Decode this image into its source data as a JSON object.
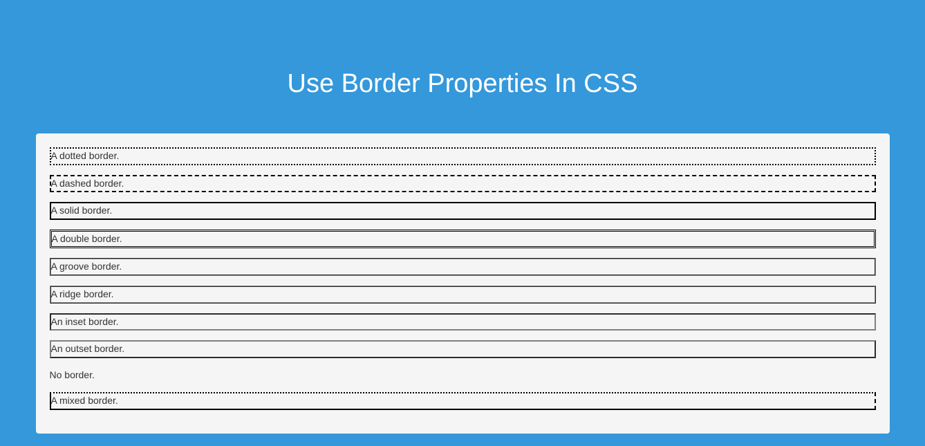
{
  "title": "Use Border Properties In CSS",
  "items": {
    "dotted": "A dotted border.",
    "dashed": "A dashed border.",
    "solid": "A solid border.",
    "double": "A double border.",
    "groove": "A groove border.",
    "ridge": "A ridge border.",
    "inset": "An inset border.",
    "outset": "An outset border.",
    "none": "No border.",
    "mixed": "A mixed border."
  }
}
